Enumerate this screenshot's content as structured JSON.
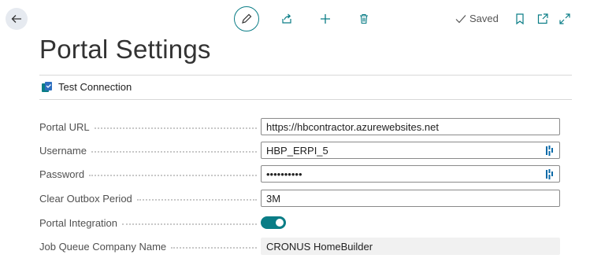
{
  "header": {
    "saved_label": "Saved"
  },
  "page": {
    "title": "Portal Settings"
  },
  "actions": {
    "test_connection": "Test Connection"
  },
  "fields": {
    "portal_url": {
      "label": "Portal URL",
      "value": "https://hbcontractor.azurewebsites.net"
    },
    "username": {
      "label": "Username",
      "value": "HBP_ERPI_5"
    },
    "password": {
      "label": "Password",
      "value": "••••••••••"
    },
    "clear_outbox_period": {
      "label": "Clear Outbox Period",
      "value": "3M"
    },
    "portal_integration": {
      "label": "Portal Integration",
      "on": true
    },
    "job_queue_company_name": {
      "label": "Job Queue Company Name",
      "value": "CRONUS HomeBuilder"
    }
  },
  "colors": {
    "accent": "#0a7d86",
    "back_circle": "#e6eaf0"
  },
  "icons": [
    "back-arrow-icon",
    "edit-icon",
    "share-icon",
    "add-icon",
    "delete-icon",
    "check-icon",
    "bookmark-icon",
    "open-new-window-icon",
    "expand-icon",
    "test-connection-icon",
    "password-manager-icon"
  ]
}
